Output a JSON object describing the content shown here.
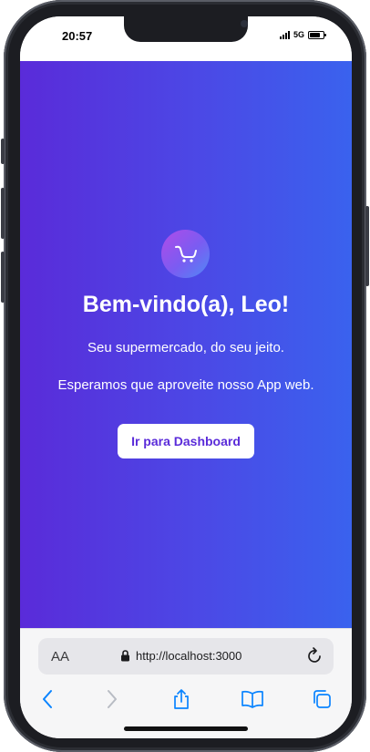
{
  "status_bar": {
    "time": "20:57",
    "network": "5G"
  },
  "hero": {
    "logo_icon": "shopping-cart-icon",
    "title": "Bem-vindo(a), Leo!",
    "subtitle": "Seu supermercado, do seu jeito.",
    "message": "Esperamos que aproveite nosso App web.",
    "cta_label": "Ir para Dashboard",
    "gradient": [
      "#5a2bd9",
      "#3a62ee"
    ]
  },
  "browser": {
    "text_size_label": "AA",
    "url": "http://localhost:3000",
    "toolbar": [
      "back-icon",
      "forward-icon",
      "share-icon",
      "bookmarks-icon",
      "tabs-icon"
    ],
    "accent": "#0a84ff"
  }
}
